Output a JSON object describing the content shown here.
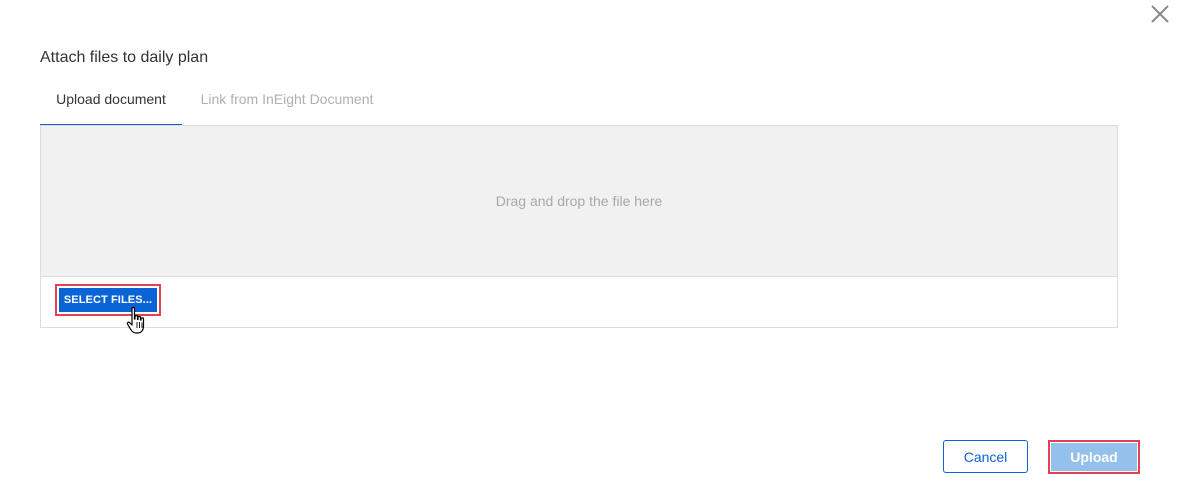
{
  "dialog": {
    "title": "Attach files to daily plan"
  },
  "tabs": [
    {
      "label": "Upload document",
      "active": true
    },
    {
      "label": "Link from InEight Document",
      "active": false
    }
  ],
  "dropzone": {
    "text": "Drag and drop the file here"
  },
  "buttons": {
    "select_files": "SELECT FILES...",
    "cancel": "Cancel",
    "upload": "Upload"
  },
  "icons": {
    "close": "close-icon",
    "cursor": "hand-pointer-cursor"
  },
  "colors": {
    "accent": "#0a64d6",
    "highlight": "#e0434f",
    "upload_disabled": "#94c0ec",
    "dropzone_bg": "#f1f1f1"
  }
}
